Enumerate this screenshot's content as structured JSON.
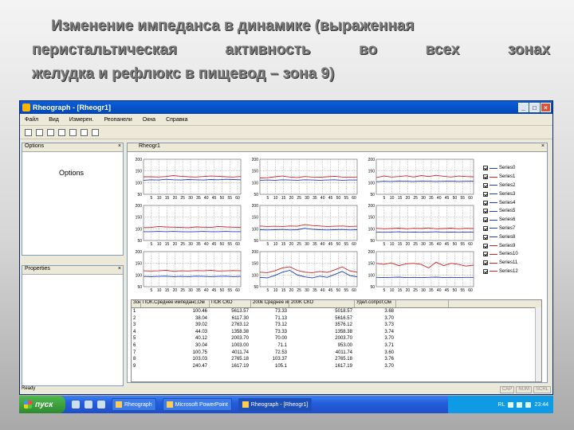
{
  "slide": {
    "title_line1": "Изменение импеданса в динамике (выраженная",
    "title_line2": "перистальтическая активность во всех зонах",
    "title_line3": "желудка и рефлюкс в пищевод – зона 9)"
  },
  "window": {
    "title": "Rheograph - [Rheogr1]",
    "menu": [
      "Файл",
      "Вид",
      "Измерен.",
      "Реопанели",
      "Окна",
      "Справка"
    ],
    "options_panel_title": "Options",
    "options_label": "Options",
    "properties_panel_title": "Properties",
    "chart_tab": "Rheogr1",
    "status": "Ready",
    "status_indicators": [
      "CAP",
      "NUM",
      "SCRL"
    ]
  },
  "chart_data": {
    "type": "line",
    "panels_layout": "3 columns x 3 rows",
    "y_ticks": [
      "200",
      "150",
      "100",
      "50"
    ],
    "x_ticks": [
      "5",
      "10",
      "15",
      "20",
      "25",
      "30",
      "35",
      "40",
      "45",
      "50",
      "55",
      "60"
    ],
    "ylim": [
      50,
      200
    ],
    "xlim": [
      0,
      62
    ],
    "legend_placement": "right",
    "series": [
      {
        "name": "Series0",
        "color": "#1a3cc8"
      },
      {
        "name": "Series1",
        "color": "#d42020"
      },
      {
        "name": "Series2",
        "color": "#1a3cc8"
      },
      {
        "name": "Series3",
        "color": "#1a3cc8"
      },
      {
        "name": "Series4",
        "color": "#1a3cc8"
      },
      {
        "name": "Series5",
        "color": "#1a3cc8"
      },
      {
        "name": "Series6",
        "color": "#1a3cc8"
      },
      {
        "name": "Series7",
        "color": "#1a3cc8"
      },
      {
        "name": "Series8",
        "color": "#1a3cc8"
      },
      {
        "name": "Series9",
        "color": "#d42020"
      },
      {
        "name": "Series10",
        "color": "#d42020"
      },
      {
        "name": "Series11",
        "color": "#d42020"
      },
      {
        "name": "Series12",
        "color": "#d42020"
      }
    ],
    "panels": [
      {
        "red": [
          125,
          125,
          124,
          126,
          130,
          127,
          125,
          124,
          126,
          128,
          127,
          125,
          124,
          126
        ],
        "blue": [
          110,
          112,
          111,
          114,
          112,
          111,
          113,
          112,
          111,
          113,
          112,
          114,
          113,
          112
        ]
      },
      {
        "red": [
          120,
          121,
          125,
          128,
          124,
          122,
          126,
          124,
          123,
          125,
          127,
          124,
          123,
          124
        ],
        "blue": [
          110,
          111,
          110,
          112,
          111,
          110,
          112,
          111,
          110,
          111,
          112,
          110,
          111,
          111
        ]
      },
      {
        "red": [
          122,
          128,
          124,
          126,
          129,
          124,
          130,
          126,
          131,
          127,
          124,
          128,
          126,
          125
        ],
        "blue": [
          104,
          106,
          105,
          107,
          106,
          105,
          107,
          106,
          105,
          106,
          107,
          105,
          106,
          106
        ]
      },
      {
        "red": [
          105,
          106,
          110,
          108,
          107,
          106,
          105,
          108,
          107,
          106,
          110,
          108,
          107,
          106
        ],
        "blue": [
          88,
          88,
          89,
          88,
          89,
          88,
          87,
          88,
          89,
          88,
          88,
          89,
          88,
          88
        ]
      },
      {
        "red": [
          112,
          110,
          111,
          110,
          112,
          111,
          118,
          114,
          112,
          110,
          111,
          112,
          110,
          111
        ],
        "blue": [
          96,
          95,
          96,
          97,
          95,
          96,
          102,
          98,
          96,
          95,
          96,
          97,
          95,
          96
        ]
      },
      {
        "red": [
          102,
          100,
          101,
          103,
          100,
          102,
          101,
          104,
          100,
          101,
          103,
          100,
          102,
          101
        ],
        "blue": [
          86,
          85,
          86,
          87,
          85,
          86,
          85,
          86,
          87,
          85,
          86,
          85,
          86,
          86
        ]
      },
      {
        "red": [
          118,
          117,
          118,
          120,
          116,
          118,
          117,
          119,
          118,
          120,
          117,
          118,
          119,
          118
        ],
        "blue": [
          94,
          93,
          94,
          95,
          93,
          94,
          93,
          95,
          94,
          93,
          94,
          95,
          93,
          94
        ]
      },
      {
        "red": [
          112,
          110,
          118,
          130,
          135,
          120,
          112,
          110,
          115,
          111,
          122,
          135,
          118,
          112
        ],
        "blue": [
          90,
          88,
          98,
          112,
          120,
          100,
          92,
          88,
          95,
          90,
          102,
          115,
          98,
          92
        ]
      },
      {
        "red": [
          150,
          145,
          152,
          140,
          148,
          150,
          145,
          130,
          155,
          140,
          150,
          145,
          138,
          142
        ],
        "blue": [
          90,
          89,
          90,
          91,
          89,
          90,
          89,
          90,
          91,
          89,
          90,
          89,
          90,
          90
        ]
      }
    ]
  },
  "table": {
    "headers": [
      "Зона",
      "ПОК.Среднее импеданс,Ом",
      "ПОК СКО",
      "200k Среднее импед,Ом",
      "200K СКО",
      "Удел.сопрот,Ом",
      ""
    ],
    "rows": [
      [
        "1",
        "100.46",
        "5613.57",
        "73.33",
        "5018.57",
        "3.68",
        ""
      ],
      [
        "2",
        "38.04",
        "6117.30",
        "71.13",
        "5616.57",
        "3.70",
        ""
      ],
      [
        "3",
        "39.02",
        "2763.12",
        "73.12",
        "3576.12",
        "3.73",
        ""
      ],
      [
        "4",
        "44.03",
        "1358.38",
        "73.33",
        "1358.38",
        "3.74",
        ""
      ],
      [
        "5",
        "40.12",
        "2003.70",
        "70.00",
        "2003.70",
        "3.70",
        ""
      ],
      [
        "6",
        "30.04",
        "1003.00",
        "71.1",
        "953.00",
        "3.71",
        ""
      ],
      [
        "7",
        "100.75",
        "4011.74",
        "72.53",
        "4011.74",
        "3.60",
        ""
      ],
      [
        "8",
        "103.03",
        "2765.18",
        "103.37",
        "2765.18",
        "3.76",
        ""
      ],
      [
        "9",
        "240.47",
        "1617.19",
        "105.1",
        "1617.19",
        "3.70",
        ""
      ]
    ]
  },
  "taskbar": {
    "start_label": "пуск",
    "tasks": [
      "Rheograph",
      "Microsoft PowerPoint",
      "Rheograph - [Rheogr1]"
    ],
    "lang": "RL",
    "clock": "23:44"
  }
}
